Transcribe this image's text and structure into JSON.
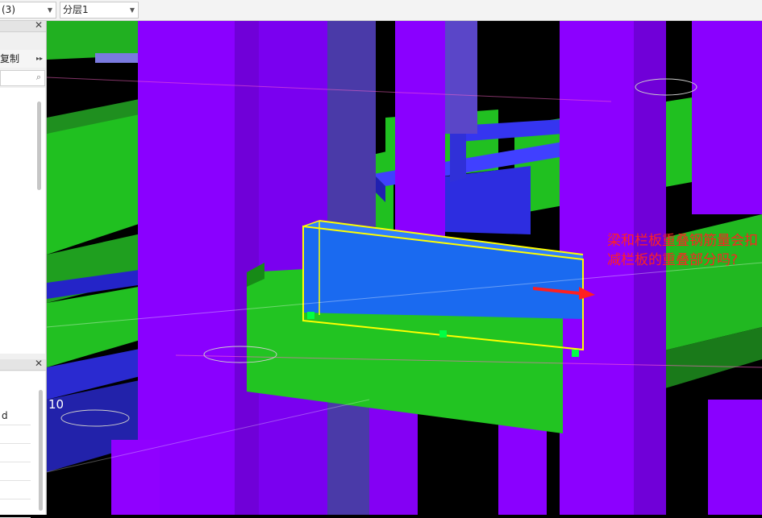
{
  "toolbar": {
    "view_combo": "(3)",
    "layer_combo": "分层1"
  },
  "left_panel": {
    "copy_label": "复制",
    "grid_first_cell": "d"
  },
  "viewport": {
    "axis_label": "10",
    "annotation_text": "梁和栏板重叠钢筋量会扣减栏板的重叠部分吗?"
  },
  "colors": {
    "column_purple": "#8a00ff",
    "slab_green": "#20c020",
    "beam_blue": "#2a2ae8",
    "selection_yellow": "#ffff00",
    "annotation_red": "#ff2222"
  },
  "icons": [
    "close-icon",
    "search-icon",
    "chevron-down-icon",
    "double-chevron-right-icon"
  ]
}
